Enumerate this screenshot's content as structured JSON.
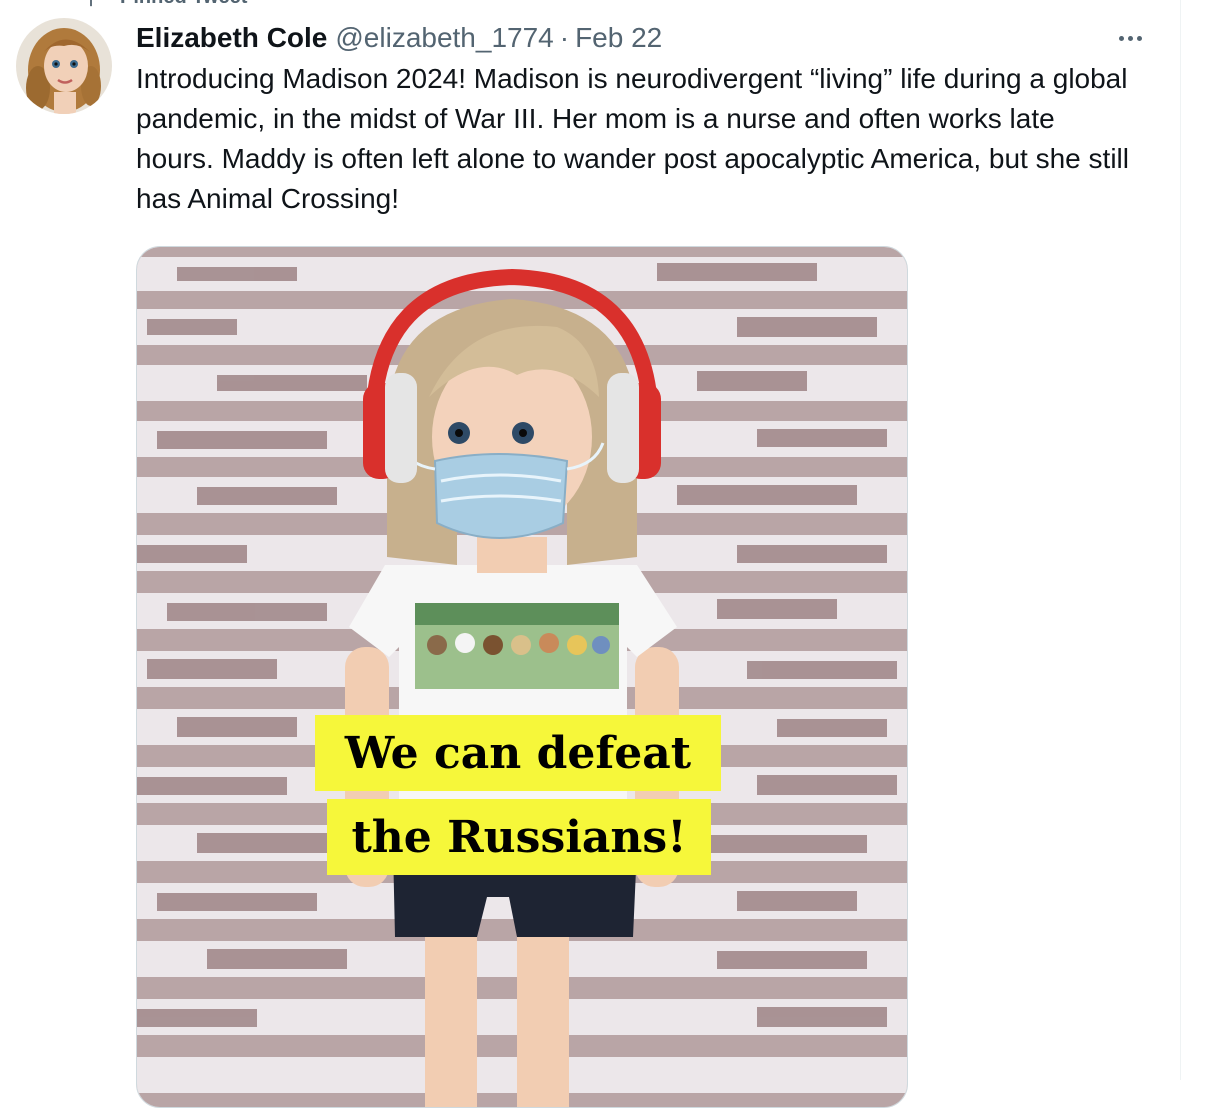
{
  "pinned": {
    "label": "Pinned Tweet",
    "icon": "pin-icon"
  },
  "tweet": {
    "author": {
      "display_name": "Elizabeth Cole",
      "handle": "@elizabeth_1774",
      "avatar_icon": "doll-avatar"
    },
    "separator": "·",
    "timestamp": "Feb 22",
    "more_icon": "more-options-icon",
    "text": "Introducing Madison 2024! Madison is neurodivergent “living” life during a global pandemic, in the midst of War III. Her mom is a nurse and often works late hours. Maddy is often left alone to wander post apocalyptic America, but she still has Animal Crossing!",
    "media": {
      "caption_line_1": "We can defeat",
      "caption_line_2": "the Russians!"
    }
  },
  "colors": {
    "text_primary": "#0f1419",
    "text_secondary": "#536471",
    "border": "#cfd9de",
    "caption_highlight": "#f6f73a",
    "headphones": "#d9302c",
    "mask": "#a9cde3"
  }
}
